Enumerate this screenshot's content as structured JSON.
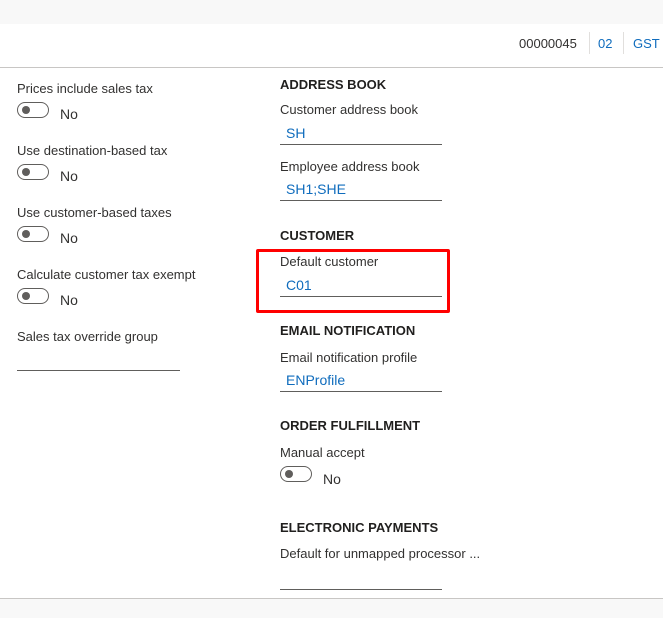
{
  "header": {
    "record_id": "00000045",
    "company": "02",
    "tax": "GST"
  },
  "left_column": {
    "prices_include_tax": {
      "label": "Prices include sales tax",
      "value": "No"
    },
    "destination_tax": {
      "label": "Use destination-based tax",
      "value": "No"
    },
    "customer_tax": {
      "label": "Use customer-based taxes",
      "value": "No"
    },
    "tax_exempt": {
      "label": "Calculate customer tax exempt",
      "value": "No"
    },
    "override_group": {
      "label": "Sales tax override group",
      "value": ""
    }
  },
  "address_book": {
    "title": "ADDRESS BOOK",
    "customer_label": "Customer address book",
    "customer_value": "SH",
    "employee_label": "Employee address book",
    "employee_value": "SH1;SHE"
  },
  "customer": {
    "title": "CUSTOMER",
    "default_label": "Default customer",
    "default_value": "C01"
  },
  "email": {
    "title": "EMAIL NOTIFICATION",
    "profile_label": "Email notification profile",
    "profile_value": "ENProfile"
  },
  "fulfillment": {
    "title": "ORDER FULFILLMENT",
    "manual_label": "Manual accept",
    "manual_value": "No"
  },
  "payments": {
    "title": "ELECTRONIC PAYMENTS",
    "unmapped_label": "Default for unmapped processor ...",
    "unmapped_value": ""
  }
}
